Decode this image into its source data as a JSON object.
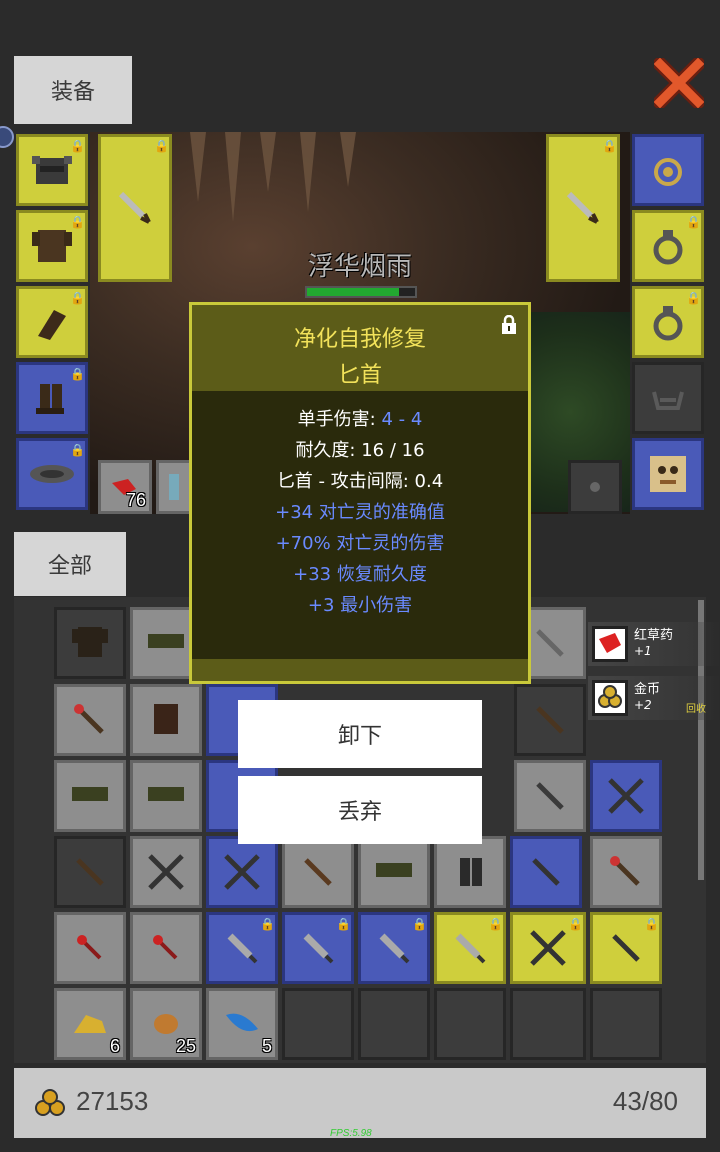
{
  "tabs": {
    "equipment_label": "装备",
    "all_label": "全部"
  },
  "player": {
    "name": "浮华烟雨",
    "hp_fraction": 0.85
  },
  "quickbar": {
    "count_1": "76"
  },
  "tooltip": {
    "title": "净化自我修复",
    "subtitle": "匕首",
    "lines": [
      {
        "label": "单手伤害: ",
        "value": "4 - 4"
      },
      {
        "text": "耐久度: 16 / 16"
      },
      {
        "text": "匕首 - 攻击间隔: 0.4"
      },
      {
        "text": "+34 对亡灵的准确值"
      },
      {
        "text": "+70% 对亡灵的伤害"
      },
      {
        "text": "+33 恢复耐久度"
      },
      {
        "text": "+3 最小伤害"
      }
    ]
  },
  "actions": {
    "unequip_label": "卸下",
    "drop_label": "丢弃"
  },
  "pickups": [
    {
      "name": "红草药",
      "count": "+1"
    },
    {
      "name": "金币",
      "count": "+2",
      "extra": "回收"
    }
  ],
  "inventory_counts": {
    "gold_ore": "6",
    "ore": "25",
    "feather": "5"
  },
  "footer": {
    "gold": "27153",
    "capacity": "43/80"
  },
  "fps": "FPS:5.98",
  "colors": {
    "rarity_yellow": "#cfcf3c",
    "rarity_blue": "#4a5ab8",
    "tooltip_blue_text": "#6a8aff",
    "title_yellow": "#f2e25a"
  }
}
